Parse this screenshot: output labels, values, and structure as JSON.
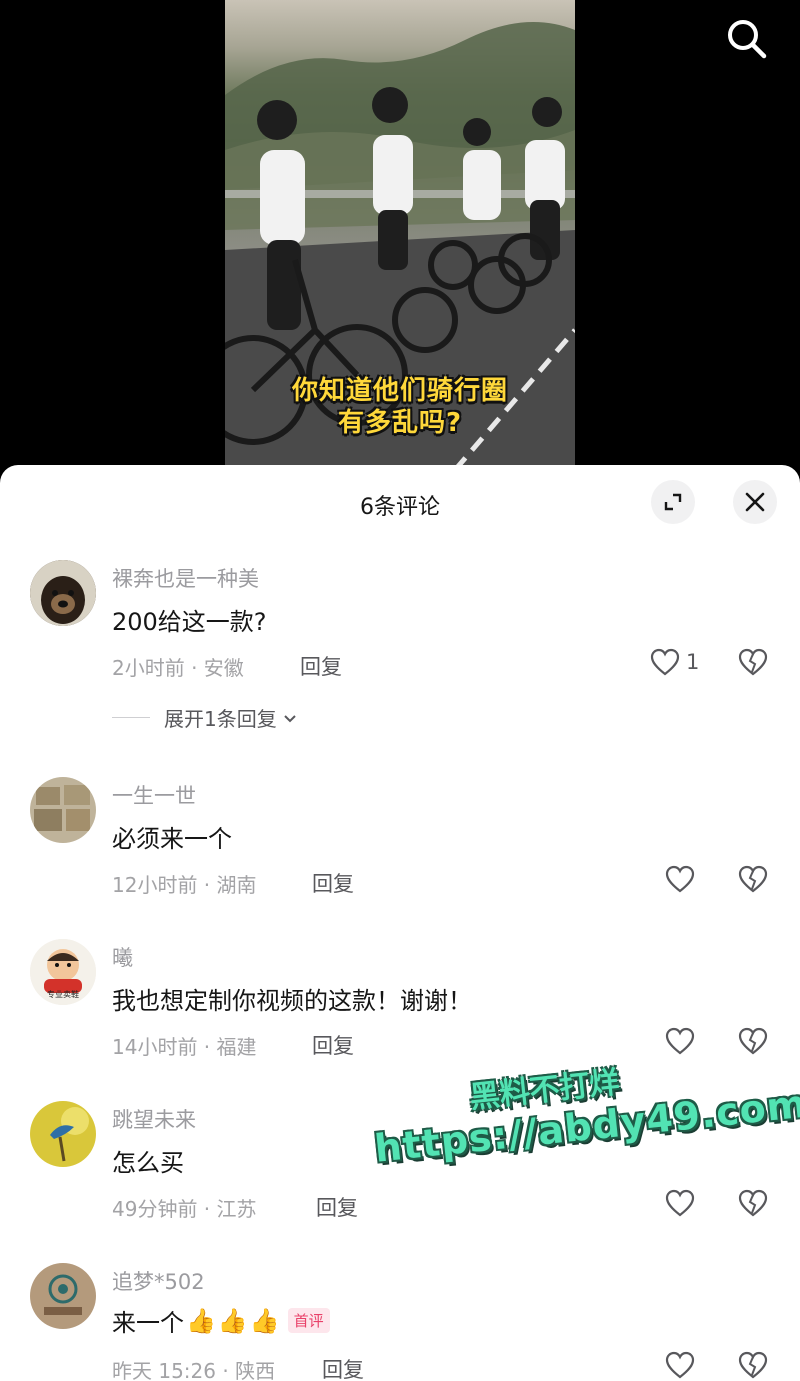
{
  "video": {
    "caption_line1": "你知道他们骑行圈",
    "caption_line2": "有多乱吗?"
  },
  "sheet": {
    "title": "6条评论"
  },
  "comments": [
    {
      "username": "裸奔也是一种美",
      "content": "200给这一款?",
      "time_location": "2小时前 · 安徽",
      "reply_label": "回复",
      "like_count": "1",
      "expand_label": "展开1条回复"
    },
    {
      "username": "一生一世",
      "content": "必须来一个",
      "time_location": "12小时前 · 湖南",
      "reply_label": "回复"
    },
    {
      "username": "曦",
      "content": "我也想定制你视频的这款！谢谢！",
      "time_location": "14小时前 · 福建",
      "reply_label": "回复",
      "avatar_text": "专业卖鞋"
    },
    {
      "username": "跳望未来",
      "content": "怎么买",
      "time_location": "49分钟前 · 江苏",
      "reply_label": "回复"
    },
    {
      "username": "追梦*502",
      "content": "来一个",
      "emoji": [
        "👍",
        "👍",
        "👍"
      ],
      "badge": "首评",
      "time_location": "昨天 15:26 · 陕西",
      "reply_label": "回复"
    }
  ],
  "watermark": {
    "line1": "黑料不打烊",
    "line2": "https://abdy49.com"
  },
  "icons": {
    "search": "search-icon",
    "expand": "expand-icon",
    "close": "close-icon",
    "like": "heart-icon",
    "dislike": "broken-heart-icon",
    "chevron": "chevron-down-icon"
  },
  "colors": {
    "caption": "#ffd83a",
    "watermark": "#52e3b3",
    "badge": "#e9426a"
  }
}
